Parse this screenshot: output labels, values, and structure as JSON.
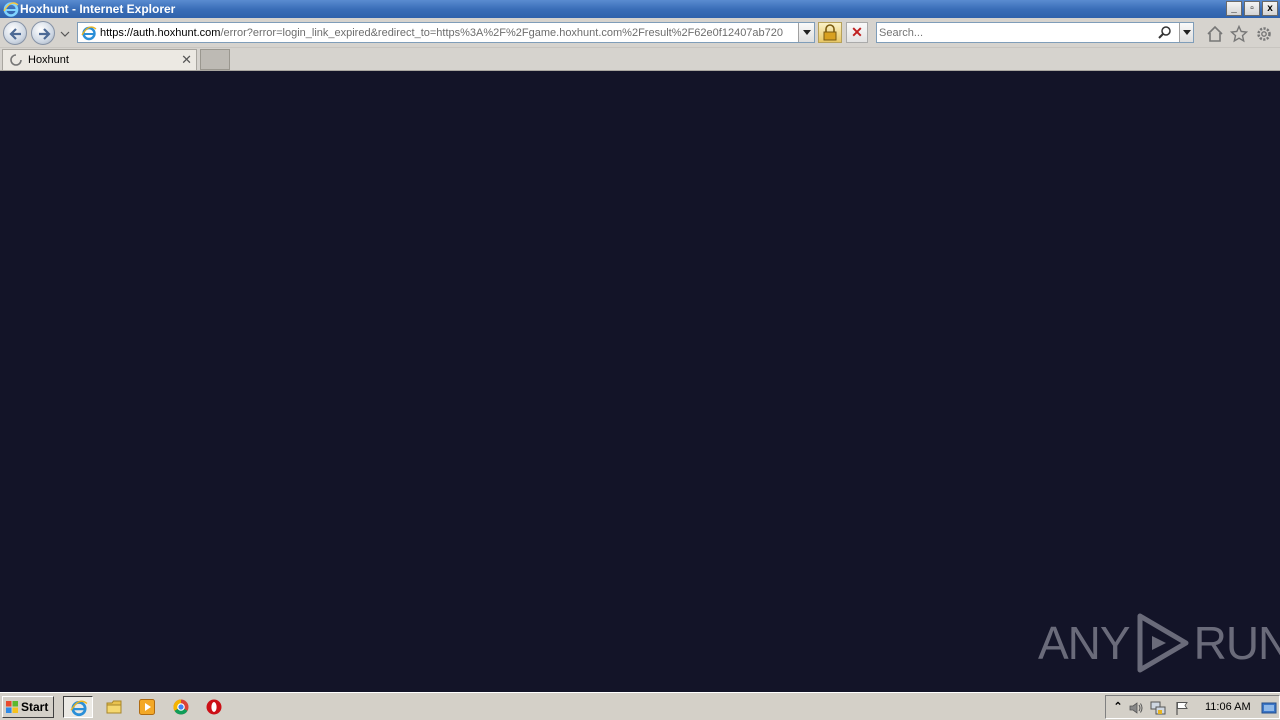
{
  "window": {
    "title": "Hoxhunt - Internet Explorer",
    "buttons": [
      "_",
      "▫",
      "x"
    ]
  },
  "navbar": {
    "url_prefix": "https://auth.",
    "url_host": "hoxhunt.com",
    "url_rest": "/error?error=login_link_expired&redirect_to=https%3A%2F%2Fgame.hoxhunt.com%2Fresult%2F62e0f12407ab720",
    "stop_label": "✕",
    "search_placeholder": "Search..."
  },
  "tabs": [
    {
      "label": "Hoxhunt",
      "close": "✕"
    }
  ],
  "watermark": {
    "left": "ANY",
    "right": "RUN"
  },
  "taskbar": {
    "start_label": "Start",
    "clock": "11:06 AM",
    "tray_up": "⌃"
  }
}
